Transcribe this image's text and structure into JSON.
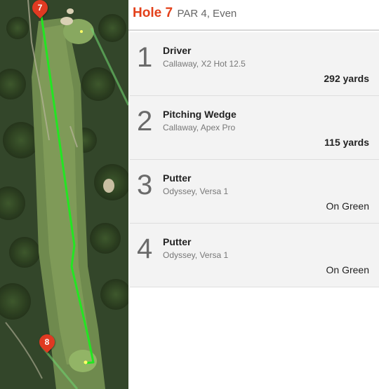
{
  "map": {
    "pin_start_label": "7",
    "pin_end_label": "8",
    "route_color": "#22e622",
    "pin_color": "#e03a22"
  },
  "header": {
    "hole": "Hole 7",
    "par_info": "PAR 4, Even"
  },
  "shots": [
    {
      "number": "1",
      "club": "Driver",
      "model": "Callaway, X2 Hot 12.5",
      "result": "292 yards"
    },
    {
      "number": "2",
      "club": "Pitching Wedge",
      "model": "Callaway, Apex Pro",
      "result": "115 yards"
    },
    {
      "number": "3",
      "club": "Putter",
      "model": "Odyssey, Versa 1",
      "result": "On Green"
    },
    {
      "number": "4",
      "club": "Putter",
      "model": "Odyssey, Versa 1",
      "result": "On Green"
    }
  ],
  "colors": {
    "accent": "#e3401a"
  }
}
